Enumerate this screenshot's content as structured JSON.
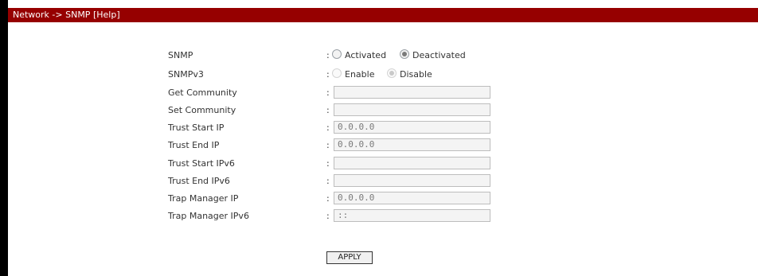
{
  "header": {
    "breadcrumb": "Network -> SNMP",
    "help": "[Help]"
  },
  "form": {
    "snmp": {
      "label": "SNMP",
      "colon": ":",
      "options": [
        {
          "label": "Activated",
          "checked": false
        },
        {
          "label": "Deactivated",
          "checked": true
        }
      ]
    },
    "snmpv3": {
      "label": "SNMPv3",
      "colon": ":",
      "options": [
        {
          "label": "Enable",
          "checked": false
        },
        {
          "label": "Disable",
          "checked": true
        }
      ]
    },
    "fields": [
      {
        "label": "Get Community",
        "value": ""
      },
      {
        "label": "Set Community",
        "value": ""
      },
      {
        "label": "Trust Start IP",
        "value": "0.0.0.0"
      },
      {
        "label": "Trust End IP",
        "value": "0.0.0.0"
      },
      {
        "label": "Trust Start IPv6",
        "value": ""
      },
      {
        "label": "Trust End IPv6",
        "value": ""
      },
      {
        "label": "Trap Manager IP",
        "value": "0.0.0.0"
      },
      {
        "label": "Trap Manager IPv6",
        "value": "::"
      }
    ],
    "apply_label": "APPLY"
  }
}
